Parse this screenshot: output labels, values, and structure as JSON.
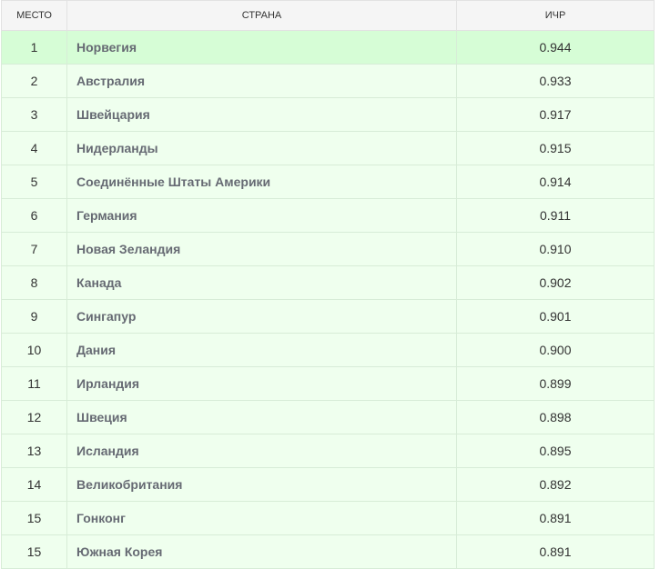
{
  "table": {
    "headers": {
      "rank": "МЕСТО",
      "country": "СТРАНА",
      "hdi": "ИЧР"
    },
    "rows": [
      {
        "rank": "1",
        "country": "Норвегия",
        "hdi": "0.944"
      },
      {
        "rank": "2",
        "country": "Австралия",
        "hdi": "0.933"
      },
      {
        "rank": "3",
        "country": "Швейцария",
        "hdi": "0.917"
      },
      {
        "rank": "4",
        "country": "Нидерланды",
        "hdi": "0.915"
      },
      {
        "rank": "5",
        "country": "Соединённые Штаты Америки",
        "hdi": "0.914"
      },
      {
        "rank": "6",
        "country": "Германия",
        "hdi": "0.911"
      },
      {
        "rank": "7",
        "country": "Новая Зеландия",
        "hdi": "0.910"
      },
      {
        "rank": "8",
        "country": "Канада",
        "hdi": "0.902"
      },
      {
        "rank": "9",
        "country": "Сингапур",
        "hdi": "0.901"
      },
      {
        "rank": "10",
        "country": "Дания",
        "hdi": "0.900"
      },
      {
        "rank": "11",
        "country": "Ирландия",
        "hdi": "0.899"
      },
      {
        "rank": "12",
        "country": "Швеция",
        "hdi": "0.898"
      },
      {
        "rank": "13",
        "country": "Исландия",
        "hdi": "0.895"
      },
      {
        "rank": "14",
        "country": "Великобритания",
        "hdi": "0.892"
      },
      {
        "rank": "15",
        "country": "Гонконг",
        "hdi": "0.891"
      },
      {
        "rank": "15",
        "country": "Южная Корея",
        "hdi": "0.891"
      }
    ]
  },
  "colors": {
    "header_bg": "#f5f5f5",
    "row_bg": "#efffee",
    "highlight_row_bg": "#d6fdd6",
    "country_text": "#666a73"
  }
}
